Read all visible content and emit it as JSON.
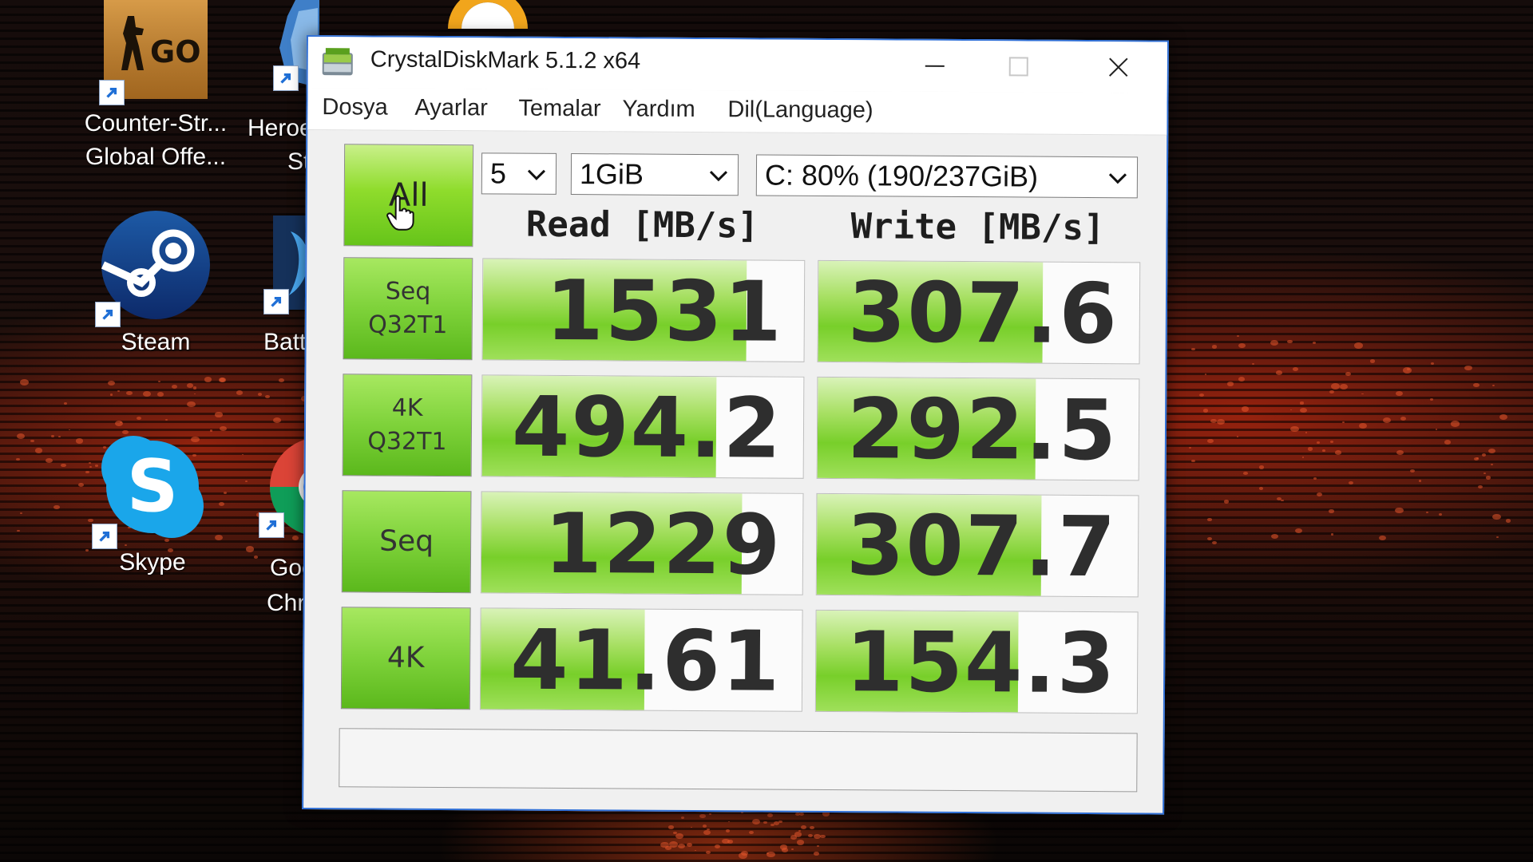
{
  "desktop": {
    "icons": [
      {
        "name": "csgo",
        "label_lines": [
          "Counter-Str...",
          "Global Offe..."
        ],
        "logo_text": "GO"
      },
      {
        "name": "steam",
        "label_lines": [
          "Steam"
        ]
      },
      {
        "name": "skype",
        "label_lines": [
          "Skype"
        ],
        "logo_text": "S"
      }
    ],
    "partial_icons": [
      {
        "name": "heroes",
        "label_lines": [
          "Heroe",
          "Sto"
        ]
      },
      {
        "name": "battlenet",
        "label_lines": [
          "Batt"
        ]
      },
      {
        "name": "chrome",
        "label_lines": [
          "Goo",
          "Chr"
        ]
      }
    ]
  },
  "window": {
    "title": "CrystalDiskMark 5.1.2 x64",
    "menu": [
      "Dosya",
      "Ayarlar",
      "Temalar",
      "Yardım",
      "Dil(Language)"
    ],
    "all_button_label": "All",
    "count_select": "5",
    "size_select": "1GiB",
    "drive_select": "C: 80% (190/237GiB)",
    "read_header": "Read [MB/s]",
    "write_header": "Write [MB/s]",
    "rows": [
      {
        "label_lines": [
          "Seq",
          "Q32T1"
        ],
        "read": "1531",
        "write": "307.6",
        "read_fill": 0.82,
        "write_fill": 0.7
      },
      {
        "label_lines": [
          "4K",
          "Q32T1"
        ],
        "read": "494.2",
        "write": "292.5",
        "read_fill": 0.73,
        "write_fill": 0.68
      },
      {
        "label_lines": [
          "Seq"
        ],
        "read": "1229",
        "write": "307.7",
        "read_fill": 0.81,
        "write_fill": 0.7
      },
      {
        "label_lines": [
          "4K"
        ],
        "read": "41.61",
        "write": "154.3",
        "read_fill": 0.51,
        "write_fill": 0.63
      }
    ],
    "comment": ""
  },
  "colors": {
    "window_border": "#2f6fd6",
    "bar_green": "#78cf2a",
    "button_green": "#7ed23a"
  }
}
